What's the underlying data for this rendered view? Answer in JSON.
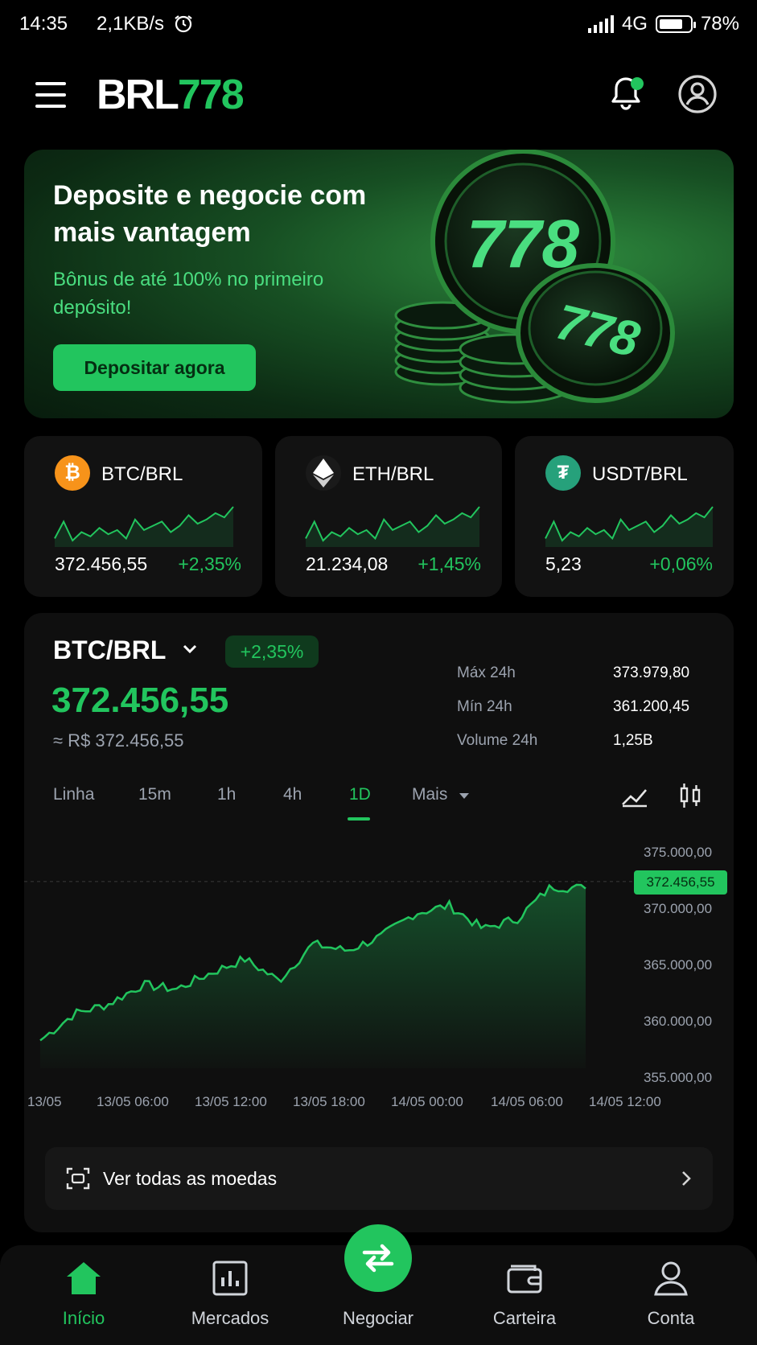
{
  "status_bar": {
    "time": "14:35",
    "net_speed": "2,1KB/s",
    "network": "4G",
    "battery": "78%",
    "battery_level": 0.78
  },
  "header": {
    "logo_main": "BRL",
    "logo_accent": "778"
  },
  "banner": {
    "title": "Deposite e negocie com mais vantagem",
    "bonus": "Bônus de até 100% no primeiro depósito!",
    "button": "Depositar agora",
    "coin_text": "778"
  },
  "tickers": [
    {
      "pair": "BTC/BRL",
      "price": "372.456,55",
      "change": "+2,35%",
      "icon": "bitcoin-icon",
      "color": "#f7931a"
    },
    {
      "pair": "ETH/BRL",
      "price": "21.234,08",
      "change": "+1,45%",
      "icon": "ethereum-icon",
      "color": "#ffffff"
    },
    {
      "pair": "USDT/BRL",
      "price": "5,23",
      "change": "+0,06%",
      "icon": "tether-icon",
      "color": "#26a17b"
    }
  ],
  "market": {
    "pair": "BTC/BRL",
    "change": "+2,35%",
    "price": "372.456,55",
    "approx": "≈ R$ 372.456,55",
    "stats": [
      {
        "label": "Máx 24h",
        "value": "373.979,80"
      },
      {
        "label": "Mín 24h",
        "value": "361.200,45"
      },
      {
        "label": "Volume 24h",
        "value": "1,25B"
      }
    ],
    "timeframes": [
      "Linha",
      "15m",
      "1h",
      "4h",
      "1D",
      "Mais"
    ],
    "active_timeframe": "1D",
    "current_badge": "372.456,55"
  },
  "chart_data": {
    "type": "area",
    "x": [
      "13/05",
      "13/05 06:00",
      "13/05 12:00",
      "13/05 18:00",
      "14/05 00:00",
      "14/05 06:00",
      "14/05 12:00"
    ],
    "series": [
      {
        "values": [
          357600,
          360100,
          361000,
          362800,
          362400,
          363900,
          365200,
          363200,
          366600,
          366000,
          367300,
          369500,
          370200,
          368000,
          369000,
          372000,
          371800
        ]
      }
    ],
    "yticks": [
      "375.000,00",
      "370.000,00",
      "365.000,00",
      "360.000,00",
      "355.000,00"
    ],
    "ylim": [
      355000,
      375000
    ],
    "current": 372456.55,
    "accent": "#22c55e"
  },
  "all_coins": {
    "label": "Ver todas as moedas"
  },
  "nav": [
    {
      "label": "Início",
      "icon": "home-icon"
    },
    {
      "label": "Mercados",
      "icon": "markets-icon"
    },
    {
      "label": "Negociar",
      "icon": "swap-icon"
    },
    {
      "label": "Carteira",
      "icon": "wallet-icon"
    },
    {
      "label": "Conta",
      "icon": "account-icon"
    }
  ]
}
